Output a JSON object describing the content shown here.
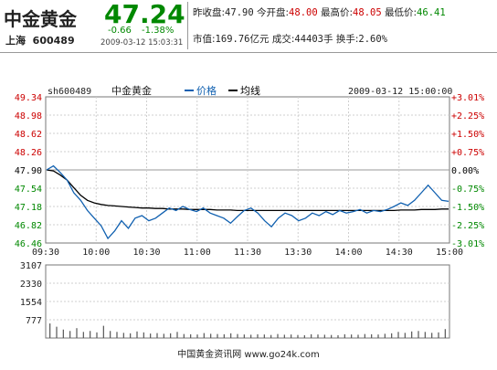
{
  "header": {
    "name": "中金黄金",
    "market": "上海",
    "code": "600489",
    "price": "47.24",
    "change": "-0.66",
    "change_pct": "-1.38%",
    "datetime": "2009-03-12 15:03:31",
    "prev_close_label": "昨收盘:",
    "prev_close": "47.90",
    "open_label": "今开盘:",
    "open": "48.00",
    "high_label": "最高价:",
    "high": "48.05",
    "low_label": "最低价:",
    "low": "46.41",
    "mcap_label": "市值:",
    "mcap": "169.76亿元",
    "volume_label": "成交:",
    "volume": "44403手",
    "turnover_label": "换手:",
    "turnover": "2.60%"
  },
  "colors": {
    "up": "#cc0000",
    "down": "#008800",
    "price_line": "#1060b0",
    "avg_line": "#000000",
    "grid": "#c8c8c8"
  },
  "footer": "中国黄金资讯网 www.go24k.com",
  "chart_data": {
    "type": "line",
    "code_label": "sh600489",
    "name_label": "中金黄金",
    "legend": [
      {
        "name": "价格",
        "color": "#1060b0"
      },
      {
        "name": "均线",
        "color": "#000000"
      }
    ],
    "timestamp": "2009-03-12 15:00:00",
    "x_ticks": [
      "09:30",
      "10:00",
      "10:30",
      "11:00",
      "11:30",
      "13:30",
      "14:00",
      "14:30",
      "15:00"
    ],
    "y_ticks": [
      "49.34",
      "48.98",
      "48.62",
      "48.26",
      "47.90",
      "47.54",
      "47.18",
      "46.82",
      "46.46"
    ],
    "ylim": [
      46.46,
      49.34
    ],
    "prev_close": 47.9,
    "pct_ticks": [
      "+3.01%",
      "+2.25%",
      "+1.50%",
      "+0.75%",
      "0.00%",
      "-0.75%",
      "-1.50%",
      "-2.25%",
      "-3.01%"
    ],
    "pct_colors": [
      "#cc0000",
      "#cc0000",
      "#cc0000",
      "#cc0000",
      "#000000",
      "#008800",
      "#008800",
      "#008800",
      "#008800"
    ],
    "price_series": [
      47.9,
      47.98,
      47.85,
      47.7,
      47.45,
      47.3,
      47.1,
      46.95,
      46.8,
      46.55,
      46.7,
      46.9,
      46.75,
      46.95,
      47.0,
      46.9,
      46.95,
      47.05,
      47.15,
      47.1,
      47.18,
      47.12,
      47.08,
      47.15,
      47.05,
      47.0,
      46.95,
      46.85,
      46.98,
      47.1,
      47.15,
      47.05,
      46.9,
      46.78,
      46.95,
      47.05,
      47.0,
      46.9,
      46.95,
      47.05,
      47.0,
      47.08,
      47.02,
      47.1,
      47.05,
      47.08,
      47.12,
      47.05,
      47.1,
      47.08,
      47.12,
      47.18,
      47.25,
      47.2,
      47.3,
      47.45,
      47.6,
      47.45,
      47.3,
      47.28
    ],
    "avg_series": [
      47.9,
      47.88,
      47.8,
      47.7,
      47.55,
      47.4,
      47.3,
      47.25,
      47.22,
      47.2,
      47.19,
      47.18,
      47.17,
      47.16,
      47.15,
      47.15,
      47.14,
      47.14,
      47.13,
      47.13,
      47.13,
      47.12,
      47.12,
      47.12,
      47.12,
      47.11,
      47.11,
      47.11,
      47.1,
      47.1,
      47.1,
      47.1,
      47.1,
      47.1,
      47.1,
      47.1,
      47.1,
      47.1,
      47.1,
      47.1,
      47.1,
      47.1,
      47.1,
      47.1,
      47.1,
      47.1,
      47.1,
      47.1,
      47.1,
      47.1,
      47.1,
      47.1,
      47.11,
      47.11,
      47.11,
      47.12,
      47.12,
      47.12,
      47.13,
      47.13
    ],
    "volume_ticks": [
      "3107",
      "2330",
      "1554",
      "777"
    ],
    "volume_max": 3107,
    "volume_series": [
      620,
      480,
      360,
      300,
      420,
      260,
      300,
      240,
      520,
      300,
      260,
      220,
      200,
      280,
      240,
      190,
      210,
      180,
      200,
      260,
      170,
      160,
      150,
      210,
      180,
      170,
      160,
      200,
      170,
      150,
      140,
      160,
      150,
      130,
      170,
      140,
      150,
      130,
      120,
      160,
      150,
      140,
      130,
      120,
      160,
      150,
      140,
      170,
      160,
      150,
      180,
      200,
      260,
      220,
      280,
      300,
      260,
      220,
      240,
      380
    ]
  }
}
